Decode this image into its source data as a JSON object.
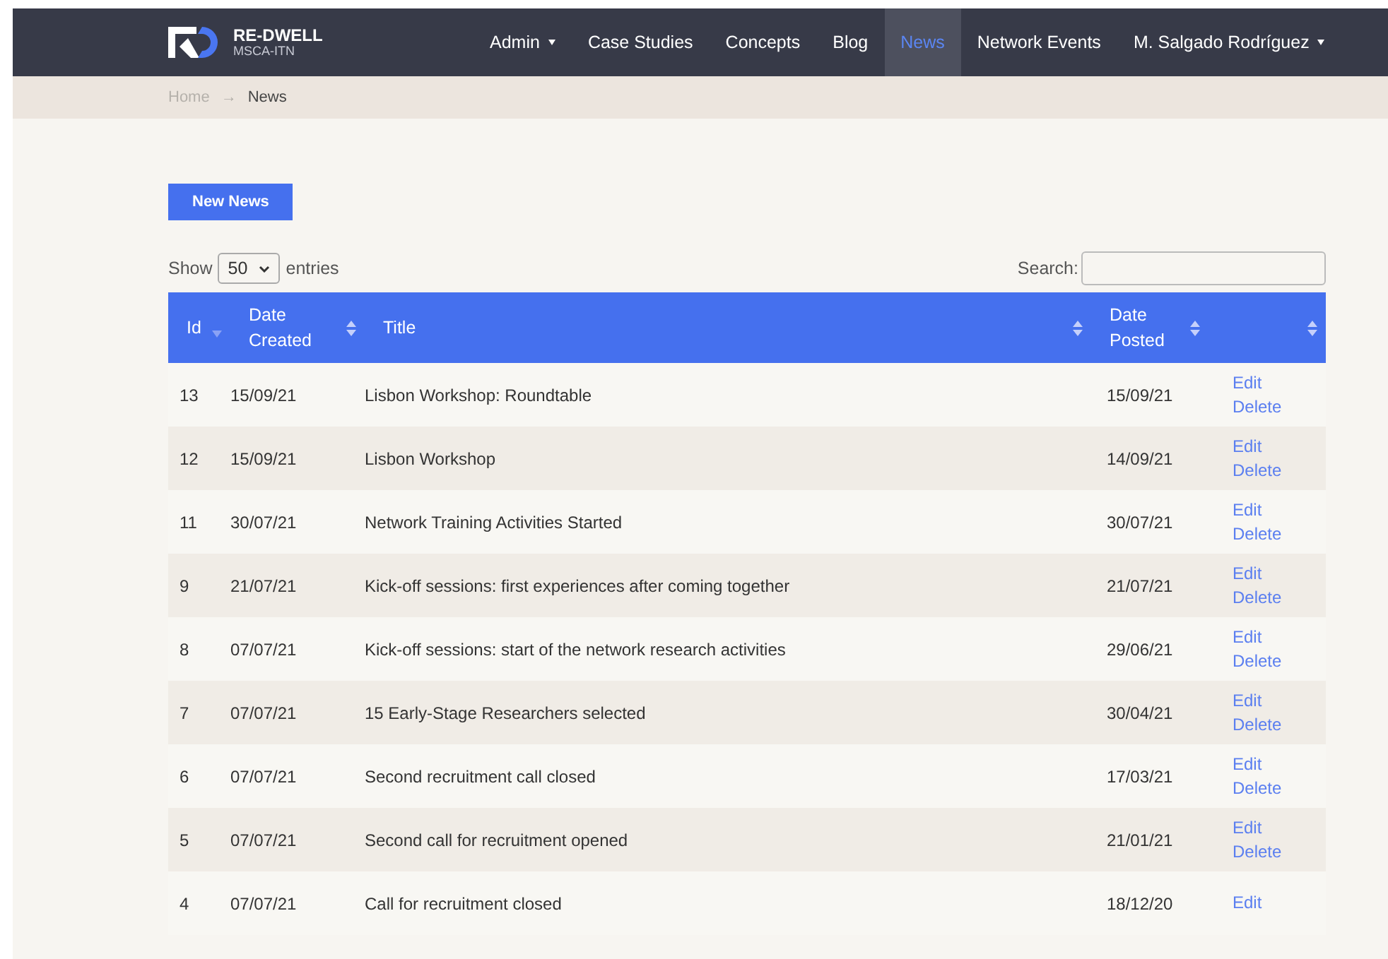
{
  "brand": {
    "name": "RE-DWELL",
    "subtitle": "MSCA-ITN"
  },
  "nav": [
    {
      "label": "Admin",
      "dropdown": true,
      "selected": false
    },
    {
      "label": "Case Studies",
      "dropdown": false,
      "selected": false
    },
    {
      "label": "Concepts",
      "dropdown": false,
      "selected": false
    },
    {
      "label": "Blog",
      "dropdown": false,
      "selected": false
    },
    {
      "label": "News",
      "dropdown": false,
      "selected": true
    },
    {
      "label": "Network Events",
      "dropdown": false,
      "selected": false
    },
    {
      "label": "M. Salgado Rodríguez",
      "dropdown": true,
      "selected": false
    }
  ],
  "breadcrumb": {
    "items": [
      "Home",
      "News"
    ],
    "separator": "→"
  },
  "new_button": "New News",
  "length": {
    "prefix": "Show",
    "value": "50",
    "suffix": "entries"
  },
  "search": {
    "label": "Search:"
  },
  "table": {
    "columns": [
      {
        "label": "Id",
        "sorted": true
      },
      {
        "label": "Date Created",
        "sorted": false
      },
      {
        "label": "Title",
        "sorted": false
      },
      {
        "label": "Date Posted",
        "sorted": false
      },
      {
        "sorted": false
      }
    ],
    "rows": [
      {
        "id": "13",
        "created": "15/09/21",
        "title": "Lisbon Workshop: Roundtable",
        "posted": "15/09/21",
        "actions": [
          "Edit",
          "Delete"
        ]
      },
      {
        "id": "12",
        "created": "15/09/21",
        "title": "Lisbon Workshop",
        "posted": "14/09/21",
        "actions": [
          "Edit",
          "Delete"
        ]
      },
      {
        "id": "11",
        "created": "30/07/21",
        "title": "Network Training Activities Started",
        "posted": "30/07/21",
        "actions": [
          "Edit",
          "Delete"
        ]
      },
      {
        "id": "9",
        "created": "21/07/21",
        "title": "Kick-off sessions: first experiences after coming together",
        "posted": "21/07/21",
        "actions": [
          "Edit",
          "Delete"
        ]
      },
      {
        "id": "8",
        "created": "07/07/21",
        "title": "Kick-off sessions: start of the network research activities",
        "posted": "29/06/21",
        "actions": [
          "Edit",
          "Delete"
        ]
      },
      {
        "id": "7",
        "created": "07/07/21",
        "title": "15 Early-Stage Researchers selected",
        "posted": "30/04/21",
        "actions": [
          "Edit",
          "Delete"
        ]
      },
      {
        "id": "6",
        "created": "07/07/21",
        "title": "Second recruitment call closed",
        "posted": "17/03/21",
        "actions": [
          "Edit",
          "Delete"
        ]
      },
      {
        "id": "5",
        "created": "07/07/21",
        "title": "Second call for recruitment opened",
        "posted": "21/01/21",
        "actions": [
          "Edit",
          "Delete"
        ]
      },
      {
        "id": "4",
        "created": "07/07/21",
        "title": "Call for recruitment closed",
        "posted": "18/12/20",
        "actions": [
          "Edit"
        ]
      }
    ]
  }
}
